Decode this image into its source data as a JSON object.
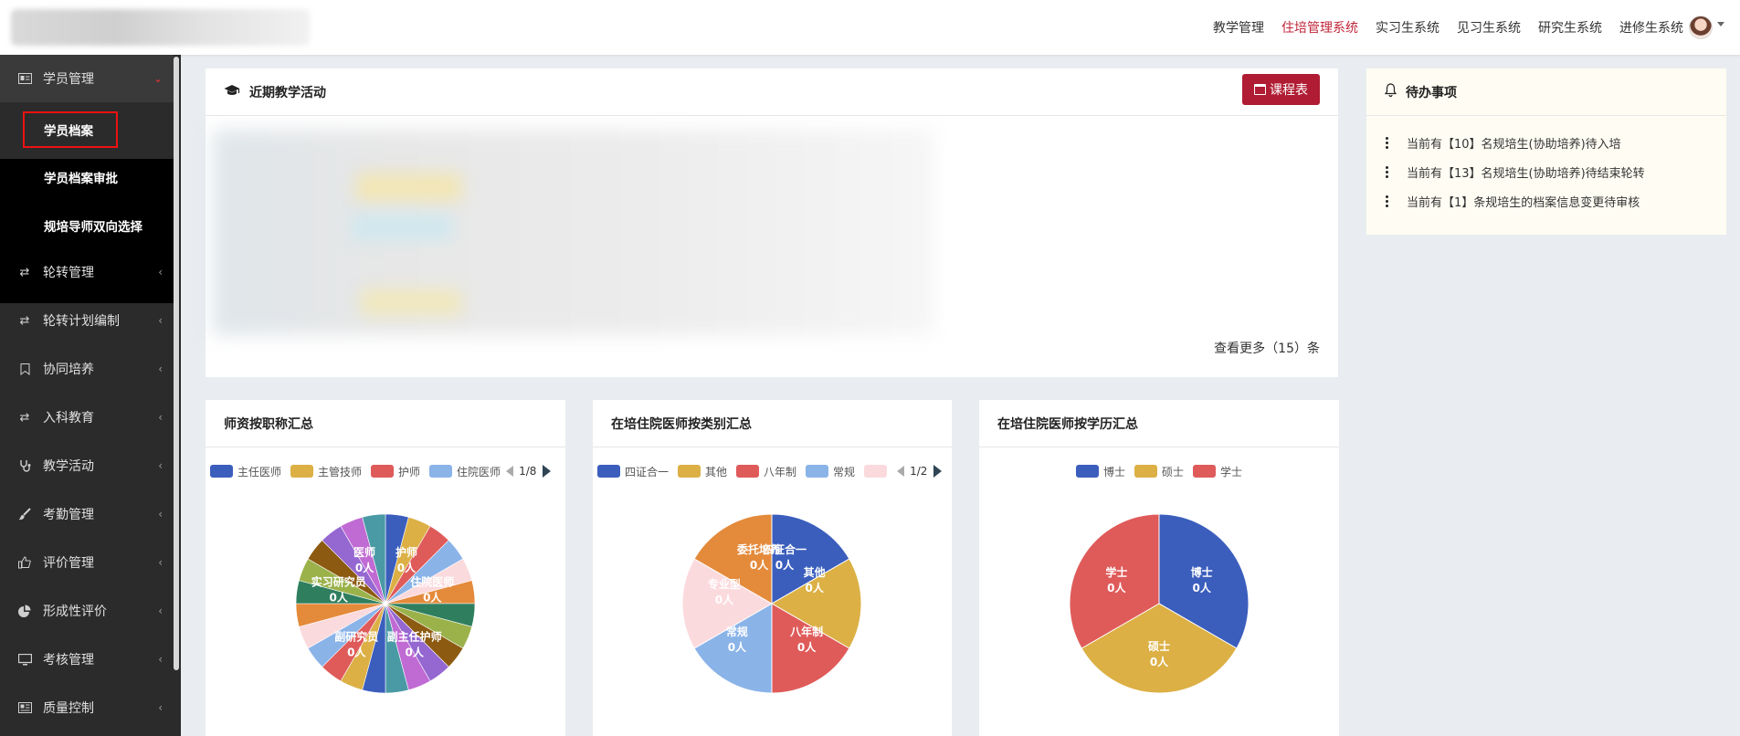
{
  "topnav": {
    "items": [
      "教学管理",
      "住培管理系统",
      "实习生系统",
      "见习生系统",
      "研究生系统",
      "进修生系统"
    ],
    "active": "住培管理系统"
  },
  "sidebar": {
    "items": [
      {
        "label": "学员管理",
        "icon": "id-card-icon"
      },
      {
        "label": "轮转管理",
        "icon": "retweet-icon"
      },
      {
        "label": "轮转计划编制",
        "icon": "retweet-icon"
      },
      {
        "label": "协同培养",
        "icon": "bookmark-icon"
      },
      {
        "label": "入科教育",
        "icon": "retweet-icon"
      },
      {
        "label": "教学活动",
        "icon": "stethoscope-icon"
      },
      {
        "label": "考勤管理",
        "icon": "brush-icon"
      },
      {
        "label": "评价管理",
        "icon": "thumbs-up-icon"
      },
      {
        "label": "形成性评价",
        "icon": "pie-chart-icon"
      },
      {
        "label": "考核管理",
        "icon": "monitor-icon"
      },
      {
        "label": "质量控制",
        "icon": "newspaper-icon"
      }
    ],
    "sub_items": [
      "学员档案",
      "学员档案审批",
      "规培导师双向选择"
    ]
  },
  "activity": {
    "title": "近期教学活动",
    "button": "课程表",
    "more": "查看更多（15）条"
  },
  "todo": {
    "title": "待办事项",
    "items": [
      "当前有【10】名规培生(协助培养)待入培",
      "当前有【13】名规培生(协助培养)待结束轮转",
      "当前有【1】条规培生的档案信息变更待审核"
    ]
  },
  "colors": {
    "accent": "#b01c33",
    "active_nav": "#c0273a",
    "sidebar_bg": "#2b2b2b"
  },
  "charts": {
    "title1": "师资按职称汇总",
    "title2": "在培住院医师按类别汇总",
    "title3": "在培住院医师按学历汇总",
    "legend1": [
      "主任医师",
      "主管技师",
      "护师",
      "住院医师"
    ],
    "legend1_page": "1/8",
    "legend2": [
      "四证合一",
      "其他",
      "八年制",
      "常规"
    ],
    "legend2_page": "1/2",
    "legend3": [
      "博士",
      "硕士",
      "学士"
    ]
  },
  "chart_data": [
    {
      "type": "pie",
      "title": "师资按职称汇总",
      "labels": [
        "医师",
        "护师",
        "住院医师",
        "实习研究员",
        "副研究员",
        "副主任护师"
      ],
      "values": [
        0,
        0,
        0,
        0,
        0,
        0
      ],
      "slice_labels": [
        "0人",
        "0人",
        "0人",
        "0人",
        "0人",
        "0人"
      ],
      "slice_count": 24,
      "legend": [
        "主任医师",
        "主管技师",
        "护师",
        "住院医师"
      ],
      "legend_page": "1/8",
      "colors": [
        "#3b5ebd",
        "#dcb045",
        "#df5b5a",
        "#8ab3e8",
        "#fbdadd",
        "#e48a3b",
        "#2f7f5f",
        "#9bb24b",
        "#8c5a10",
        "#9567d1",
        "#c06ad3",
        "#4a9aa6"
      ]
    },
    {
      "type": "pie",
      "title": "在培住院医师按类别汇总",
      "labels": [
        "四证合一",
        "其他",
        "八年制",
        "常规",
        "专业型",
        "委托培养"
      ],
      "values": [
        0,
        0,
        0,
        0,
        0,
        0
      ],
      "slice_labels": [
        "0人",
        "0人",
        "0人",
        "0人",
        "0人",
        "0人"
      ],
      "legend": [
        "四证合一",
        "其他",
        "八年制",
        "常规"
      ],
      "legend_page": "1/2",
      "colors": [
        "#3b5ebd",
        "#dcb045",
        "#df5b5a",
        "#8ab3e8",
        "#fbdadd",
        "#e48a3b"
      ]
    },
    {
      "type": "pie",
      "title": "在培住院医师按学历汇总",
      "labels": [
        "博士",
        "硕士",
        "学士"
      ],
      "values": [
        0,
        0,
        0
      ],
      "slice_labels": [
        "0人",
        "0人",
        "0人"
      ],
      "legend": [
        "博士",
        "硕士",
        "学士"
      ],
      "colors": [
        "#3b5ebd",
        "#dcb045",
        "#df5b5a"
      ]
    }
  ]
}
